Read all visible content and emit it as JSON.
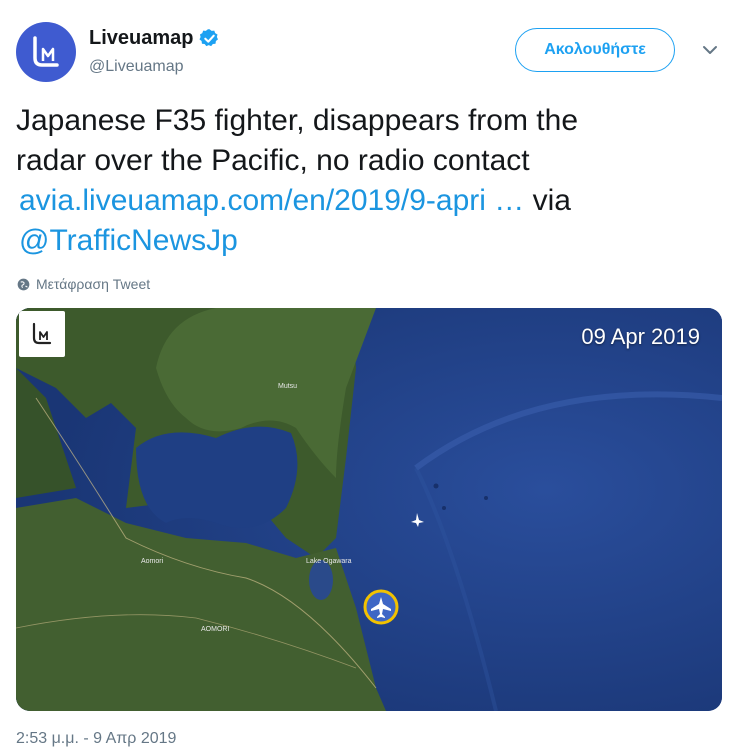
{
  "header": {
    "display_name": "Liveuamap",
    "handle": "@Liveuamap",
    "follow_label": "Ακολουθήστε",
    "avatar_logo_text": "LM"
  },
  "tweet": {
    "text_line1": "Japanese F35 fighter, disappears from the",
    "text_line2": "radar over the Pacific, no radio contact",
    "link_text": "avia.liveuamap.com/en/2019/9-apri",
    "ellipsis": " …",
    "via_text": " via",
    "mention": "@TrafficNewsJp",
    "translate_label": "Μετάφραση Tweet",
    "timestamp": "2:53 μ.μ. - 9 Απρ 2019"
  },
  "media": {
    "date_label": "09 Apr 2019",
    "place_labels": [
      "Aomori",
      "AOMORI",
      "Mutsu",
      "Lake Ogawara"
    ]
  },
  "icons": {
    "verified": "verified-badge-icon",
    "caret": "chevron-down-icon",
    "translate": "globe-icon",
    "aircraft": "airplane-icon"
  },
  "colors": {
    "accent": "#1da1f2",
    "link": "#1b95e0",
    "ocean": "#1f3f84",
    "land": "#3d5a2c",
    "aircraft_ring": "#f2c200"
  }
}
